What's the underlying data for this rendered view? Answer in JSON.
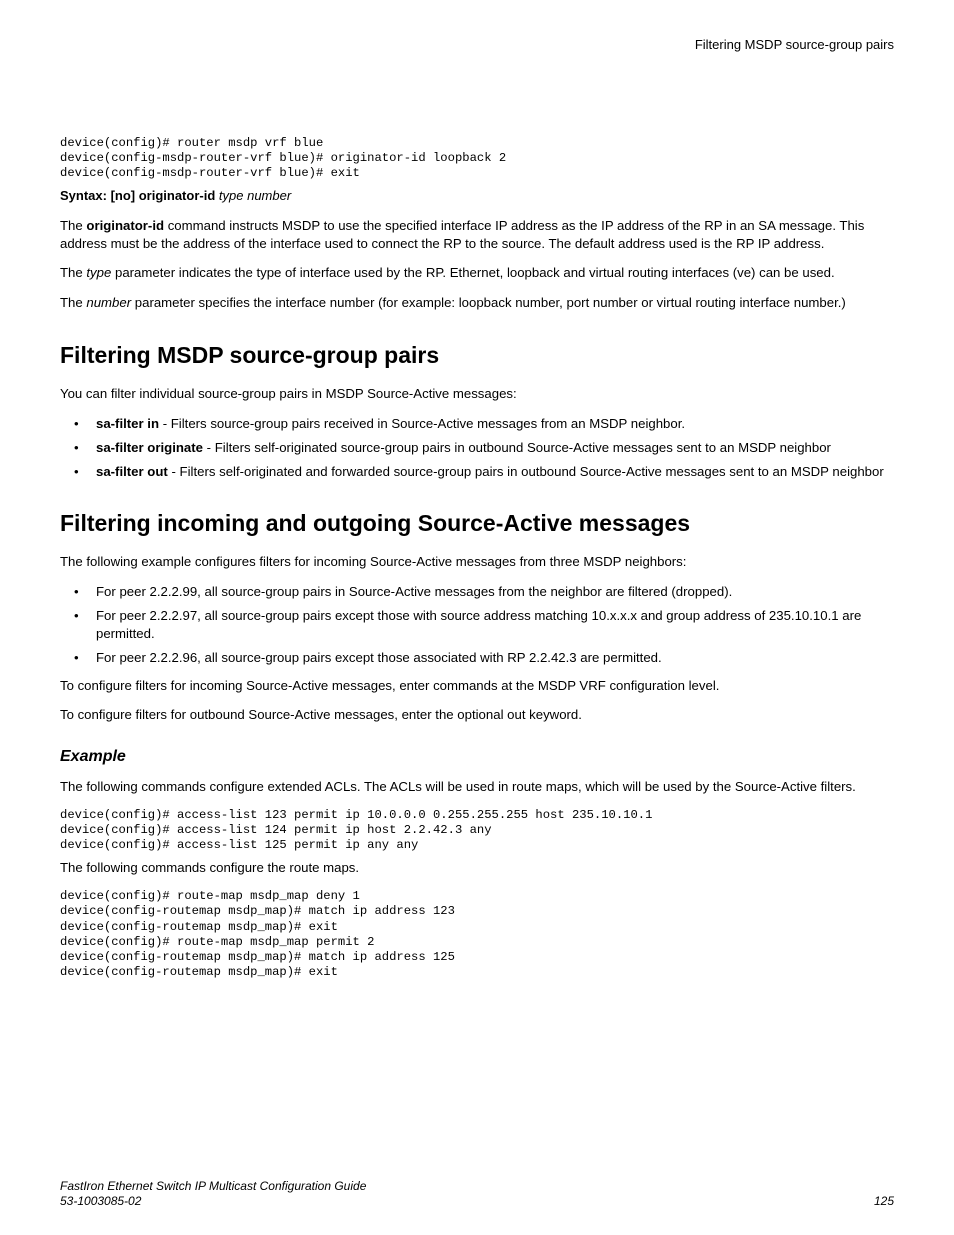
{
  "header": {
    "right": "Filtering MSDP source-group pairs"
  },
  "code1": "device(config)# router msdp vrf blue\ndevice(config-msdp-router-vrf blue)# originator-id loopback 2\ndevice(config-msdp-router-vrf blue)# exit",
  "syntax": {
    "prefix": "Syntax: [no] originator-id",
    "args": "type number"
  },
  "para1a": "The ",
  "para1b": "originator-id",
  "para1c": " command instructs MSDP to use the specified interface IP address as the IP address of the RP in an SA message. This address must be the address of the interface used to connect the RP to the source. The default address used is the RP IP address.",
  "para2a": "The ",
  "para2b": "type",
  "para2c": " parameter indicates the type of interface used by the RP. Ethernet, loopback and virtual routing interfaces (ve) can be used.",
  "para3a": "The ",
  "para3b": "number",
  "para3c": " parameter specifies the interface number (for example: loopback number, port number or virtual routing interface number.)",
  "sec1": {
    "title": "Filtering MSDP source-group pairs",
    "intro": "You can filter individual source-group pairs in MSDP Source-Active messages:",
    "b1_term": "sa-filter in",
    "b1_rest": " - Filters source-group pairs received in Source-Active messages from an MSDP neighbor.",
    "b2_term": "sa-filter originate",
    "b2_rest": " - Filters self-originated source-group pairs in outbound Source-Active messages sent to an MSDP neighbor",
    "b3_term": "sa-filter out",
    "b3_rest": " - Filters self-originated and forwarded source-group pairs in outbound Source-Active messages sent to an MSDP neighbor"
  },
  "sec2": {
    "title": "Filtering incoming and outgoing Source-Active messages",
    "intro": "The following example configures filters for incoming Source-Active messages from three MSDP neighbors:",
    "b1": "For peer 2.2.2.99, all source-group pairs in Source-Active messages from the neighbor are filtered (dropped).",
    "b2": "For peer 2.2.2.97, all source-group pairs except those with source address matching 10.x.x.x and group address of 235.10.10.1 are permitted.",
    "b3": "For peer 2.2.2.96, all source-group pairs except those associated with RP 2.2.42.3 are permitted.",
    "p2": "To configure filters for incoming Source-Active messages, enter commands at the MSDP VRF configuration level.",
    "p3": "To configure filters for outbound Source-Active messages, enter the optional out keyword."
  },
  "example": {
    "title": "Example",
    "intro": "The following commands configure extended ACLs. The ACLs will be used in route maps, which will be used by the Source-Active filters.",
    "code1": "device(config)# access-list 123 permit ip 10.0.0.0 0.255.255.255 host 235.10.10.1\ndevice(config)# access-list 124 permit ip host 2.2.42.3 any\ndevice(config)# access-list 125 permit ip any any",
    "mid": "The following commands configure the route maps.",
    "code2": "device(config)# route-map msdp_map deny 1\ndevice(config-routemap msdp_map)# match ip address 123\ndevice(config-routemap msdp_map)# exit\ndevice(config)# route-map msdp_map permit 2\ndevice(config-routemap msdp_map)# match ip address 125\ndevice(config-routemap msdp_map)# exit"
  },
  "footer": {
    "title": "FastIron Ethernet Switch IP Multicast Configuration Guide",
    "docnum": "53-1003085-02",
    "page": "125"
  }
}
